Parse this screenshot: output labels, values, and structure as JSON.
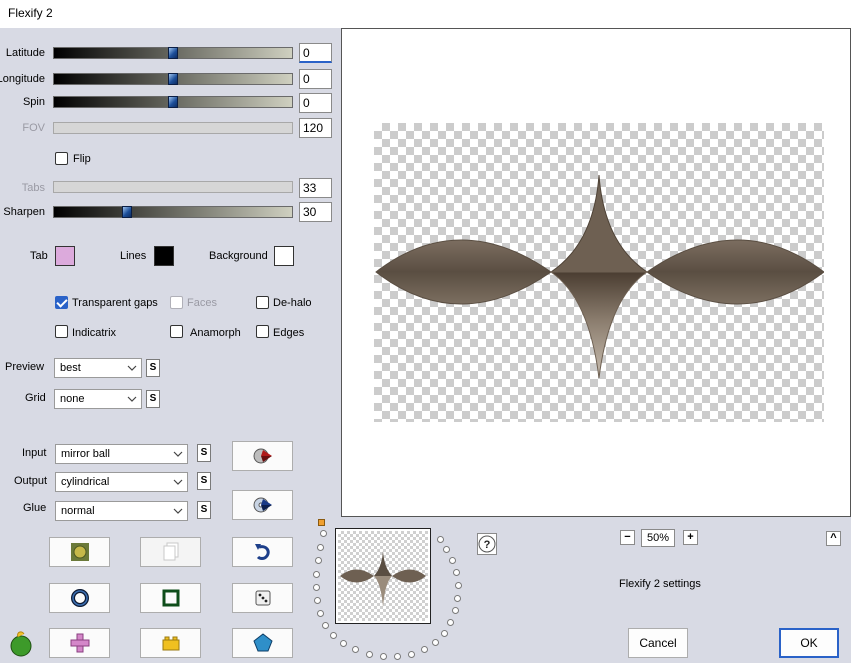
{
  "window": {
    "title": "Flexify 2"
  },
  "sliders": [
    {
      "id": "latitude",
      "label": "Latitude",
      "value": "0",
      "level": 0.5,
      "enabled": true,
      "focused": true
    },
    {
      "id": "longitude",
      "label": "Longitude",
      "value": "0",
      "level": 0.5,
      "enabled": true
    },
    {
      "id": "spin",
      "label": "Spin",
      "value": "0",
      "level": 0.5,
      "enabled": true
    },
    {
      "id": "fov",
      "label": "FOV",
      "value": "120",
      "enabled": false
    },
    {
      "id": "tabs",
      "label": "Tabs",
      "value": "33",
      "enabled": false
    },
    {
      "id": "sharpen",
      "label": "Sharpen",
      "value": "30",
      "level": 0.3,
      "enabled": true
    }
  ],
  "flip": {
    "label": "Flip",
    "checked": false
  },
  "colors": {
    "tab": {
      "label": "Tab",
      "color": "#dcaadc"
    },
    "lines": {
      "label": "Lines",
      "color": "#000000"
    },
    "background": {
      "label": "Background",
      "color": "#ffffff"
    }
  },
  "options": {
    "transparent_gaps": {
      "label": "Transparent gaps",
      "checked": true
    },
    "faces": {
      "label": "Faces",
      "checked": false,
      "enabled": false
    },
    "de_halo": {
      "label": "De-halo",
      "checked": false
    },
    "indicatrix": {
      "label": "Indicatrix",
      "checked": false
    },
    "anamorph": {
      "label": "Anamorph",
      "checked": false
    },
    "edges": {
      "label": "Edges",
      "checked": false
    }
  },
  "preview_select": {
    "label": "Preview",
    "value": "best"
  },
  "grid_select": {
    "label": "Grid",
    "value": "none"
  },
  "input_select": {
    "label": "Input",
    "value": "mirror ball"
  },
  "output_select": {
    "label": "Output",
    "value": "cylindrical"
  },
  "glue_select": {
    "label": "Glue",
    "value": "normal"
  },
  "s_button": "S",
  "zoom": {
    "value": "50%",
    "minus": "−",
    "plus": "+"
  },
  "settings_name": "Flexify 2 settings",
  "buttons": {
    "cancel": "Cancel",
    "ok": "OK",
    "help": "?",
    "collapse": "^"
  },
  "accent_color": "#2a62c8"
}
